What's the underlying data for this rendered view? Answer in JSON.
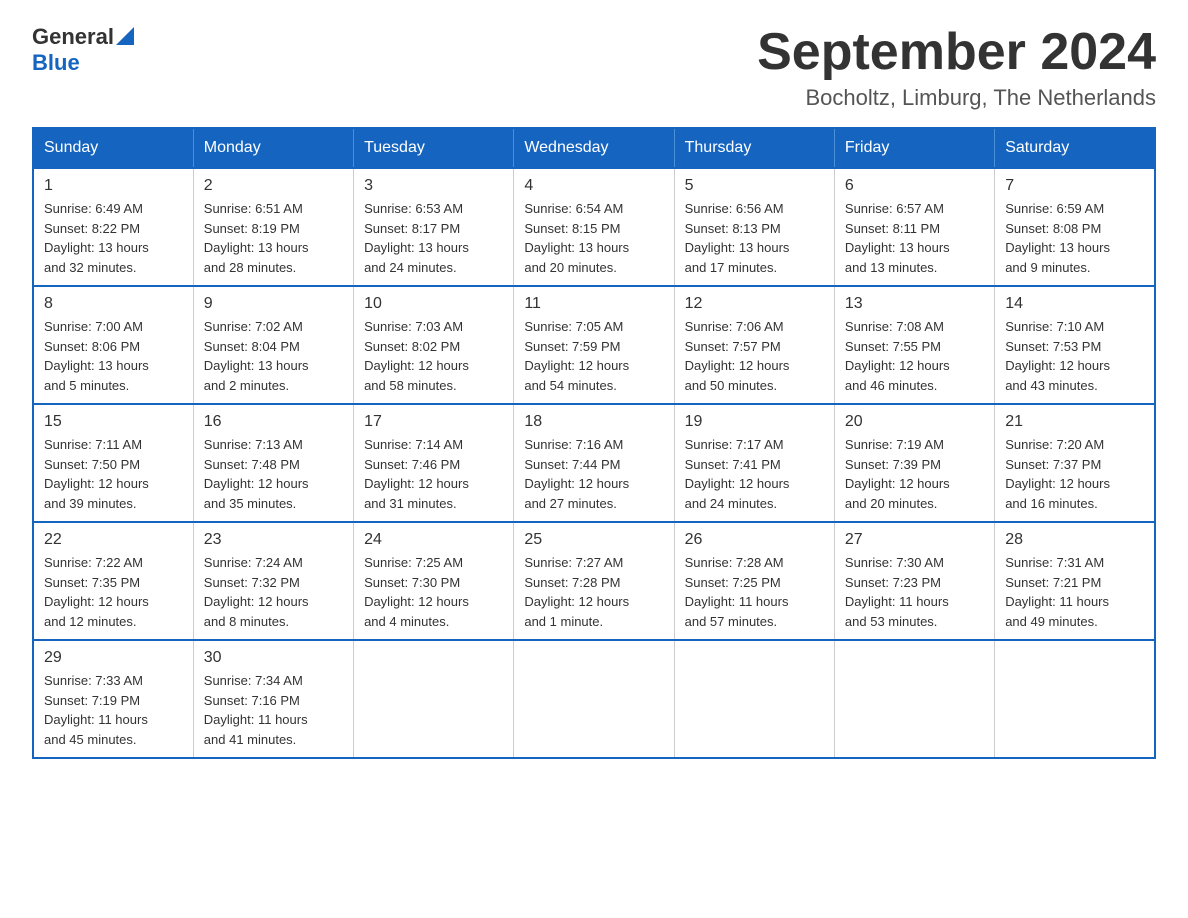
{
  "header": {
    "logo_general": "General",
    "logo_blue": "Blue",
    "month_title": "September 2024",
    "subtitle": "Bocholtz, Limburg, The Netherlands"
  },
  "weekdays": [
    "Sunday",
    "Monday",
    "Tuesday",
    "Wednesday",
    "Thursday",
    "Friday",
    "Saturday"
  ],
  "weeks": [
    [
      {
        "day": "1",
        "info": "Sunrise: 6:49 AM\nSunset: 8:22 PM\nDaylight: 13 hours\nand 32 minutes."
      },
      {
        "day": "2",
        "info": "Sunrise: 6:51 AM\nSunset: 8:19 PM\nDaylight: 13 hours\nand 28 minutes."
      },
      {
        "day": "3",
        "info": "Sunrise: 6:53 AM\nSunset: 8:17 PM\nDaylight: 13 hours\nand 24 minutes."
      },
      {
        "day": "4",
        "info": "Sunrise: 6:54 AM\nSunset: 8:15 PM\nDaylight: 13 hours\nand 20 minutes."
      },
      {
        "day": "5",
        "info": "Sunrise: 6:56 AM\nSunset: 8:13 PM\nDaylight: 13 hours\nand 17 minutes."
      },
      {
        "day": "6",
        "info": "Sunrise: 6:57 AM\nSunset: 8:11 PM\nDaylight: 13 hours\nand 13 minutes."
      },
      {
        "day": "7",
        "info": "Sunrise: 6:59 AM\nSunset: 8:08 PM\nDaylight: 13 hours\nand 9 minutes."
      }
    ],
    [
      {
        "day": "8",
        "info": "Sunrise: 7:00 AM\nSunset: 8:06 PM\nDaylight: 13 hours\nand 5 minutes."
      },
      {
        "day": "9",
        "info": "Sunrise: 7:02 AM\nSunset: 8:04 PM\nDaylight: 13 hours\nand 2 minutes."
      },
      {
        "day": "10",
        "info": "Sunrise: 7:03 AM\nSunset: 8:02 PM\nDaylight: 12 hours\nand 58 minutes."
      },
      {
        "day": "11",
        "info": "Sunrise: 7:05 AM\nSunset: 7:59 PM\nDaylight: 12 hours\nand 54 minutes."
      },
      {
        "day": "12",
        "info": "Sunrise: 7:06 AM\nSunset: 7:57 PM\nDaylight: 12 hours\nand 50 minutes."
      },
      {
        "day": "13",
        "info": "Sunrise: 7:08 AM\nSunset: 7:55 PM\nDaylight: 12 hours\nand 46 minutes."
      },
      {
        "day": "14",
        "info": "Sunrise: 7:10 AM\nSunset: 7:53 PM\nDaylight: 12 hours\nand 43 minutes."
      }
    ],
    [
      {
        "day": "15",
        "info": "Sunrise: 7:11 AM\nSunset: 7:50 PM\nDaylight: 12 hours\nand 39 minutes."
      },
      {
        "day": "16",
        "info": "Sunrise: 7:13 AM\nSunset: 7:48 PM\nDaylight: 12 hours\nand 35 minutes."
      },
      {
        "day": "17",
        "info": "Sunrise: 7:14 AM\nSunset: 7:46 PM\nDaylight: 12 hours\nand 31 minutes."
      },
      {
        "day": "18",
        "info": "Sunrise: 7:16 AM\nSunset: 7:44 PM\nDaylight: 12 hours\nand 27 minutes."
      },
      {
        "day": "19",
        "info": "Sunrise: 7:17 AM\nSunset: 7:41 PM\nDaylight: 12 hours\nand 24 minutes."
      },
      {
        "day": "20",
        "info": "Sunrise: 7:19 AM\nSunset: 7:39 PM\nDaylight: 12 hours\nand 20 minutes."
      },
      {
        "day": "21",
        "info": "Sunrise: 7:20 AM\nSunset: 7:37 PM\nDaylight: 12 hours\nand 16 minutes."
      }
    ],
    [
      {
        "day": "22",
        "info": "Sunrise: 7:22 AM\nSunset: 7:35 PM\nDaylight: 12 hours\nand 12 minutes."
      },
      {
        "day": "23",
        "info": "Sunrise: 7:24 AM\nSunset: 7:32 PM\nDaylight: 12 hours\nand 8 minutes."
      },
      {
        "day": "24",
        "info": "Sunrise: 7:25 AM\nSunset: 7:30 PM\nDaylight: 12 hours\nand 4 minutes."
      },
      {
        "day": "25",
        "info": "Sunrise: 7:27 AM\nSunset: 7:28 PM\nDaylight: 12 hours\nand 1 minute."
      },
      {
        "day": "26",
        "info": "Sunrise: 7:28 AM\nSunset: 7:25 PM\nDaylight: 11 hours\nand 57 minutes."
      },
      {
        "day": "27",
        "info": "Sunrise: 7:30 AM\nSunset: 7:23 PM\nDaylight: 11 hours\nand 53 minutes."
      },
      {
        "day": "28",
        "info": "Sunrise: 7:31 AM\nSunset: 7:21 PM\nDaylight: 11 hours\nand 49 minutes."
      }
    ],
    [
      {
        "day": "29",
        "info": "Sunrise: 7:33 AM\nSunset: 7:19 PM\nDaylight: 11 hours\nand 45 minutes."
      },
      {
        "day": "30",
        "info": "Sunrise: 7:34 AM\nSunset: 7:16 PM\nDaylight: 11 hours\nand 41 minutes."
      },
      {
        "day": "",
        "info": ""
      },
      {
        "day": "",
        "info": ""
      },
      {
        "day": "",
        "info": ""
      },
      {
        "day": "",
        "info": ""
      },
      {
        "day": "",
        "info": ""
      }
    ]
  ]
}
